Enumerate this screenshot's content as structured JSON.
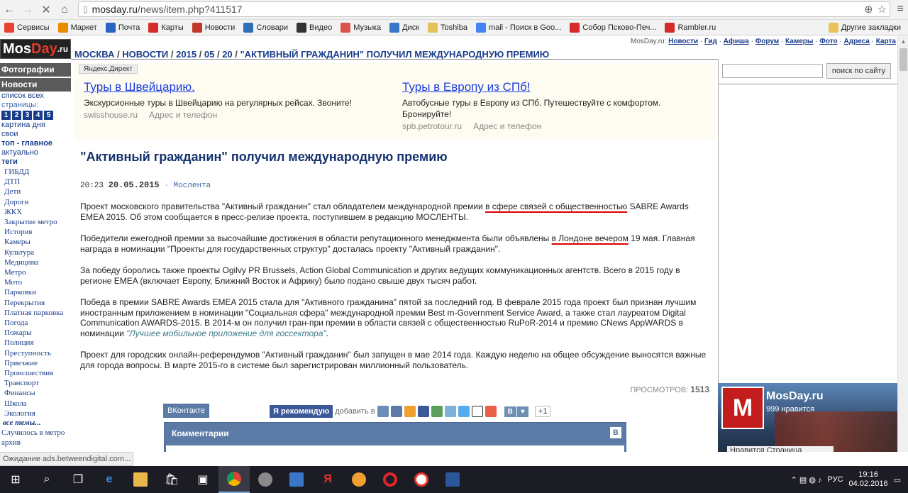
{
  "browser": {
    "url_host": "mosday.ru",
    "url_path": "/news/item.php?411517",
    "bookmarks": [
      {
        "label": "Сервисы",
        "color": "#e94235"
      },
      {
        "label": "Маркет",
        "color": "#e88b00"
      },
      {
        "label": "Почта",
        "color": "#2a63c2"
      },
      {
        "label": "Карты",
        "color": "#d62b2b"
      },
      {
        "label": "Новости",
        "color": "#c0392b"
      },
      {
        "label": "Словари",
        "color": "#2e6fb7"
      },
      {
        "label": "Видео",
        "color": "#333333"
      },
      {
        "label": "Музыка",
        "color": "#d9534f"
      },
      {
        "label": "Диск",
        "color": "#3a77c9"
      },
      {
        "label": "Toshiba",
        "color": "#e2c35a"
      },
      {
        "label": "mail - Поиск в Goo...",
        "color": "#4285f4"
      },
      {
        "label": "Собор Псково-Печ...",
        "color": "#d62b2b"
      },
      {
        "label": "Rambler.ru",
        "color": "#d62b2b"
      }
    ],
    "other_bookmarks": "Другие закладки",
    "status_text": "Ожидание ads.betweendigital.com..."
  },
  "site": {
    "logo_a": "Mos",
    "logo_b": "Day",
    "logo_c": ".ru",
    "top_prefix": "MosDay.ru:",
    "top_links": [
      "Новости",
      "Гид",
      "Афиша",
      "Форум",
      "Камеры",
      "Фото",
      "Адреса",
      "Карта"
    ],
    "breadcrumb": [
      "МОСКВА",
      "НОВОСТИ",
      "2015",
      "05",
      "20",
      "\"АКТИВНЫЙ ГРАЖДАНИН\" ПОЛУЧИЛ МЕЖДУНАРОДНУЮ ПРЕМИЮ"
    ]
  },
  "sidebar": {
    "photos": "Фотографии",
    "news": "Новости",
    "all_list": "список всех",
    "pages_label": "страницы:",
    "pages": [
      "1",
      "2",
      "3",
      "4",
      "5"
    ],
    "picture_of_day": "картина дня",
    "own": "свои",
    "top_main": "топ - главное",
    "actual": "актуально",
    "tags_label": "теги",
    "tags": [
      "ГИБДД",
      "ДТП",
      "Дети",
      "Дороги",
      "ЖКХ",
      "Закрытие метро",
      "История",
      "Камеры",
      "Культура",
      "Медицина",
      "Метро",
      "Мото",
      "Парковки",
      "Перекрытия",
      "Платная парковка",
      "Погода",
      "Пожары",
      "Полиция",
      "Преступность",
      "Приезжие",
      "Происшествия",
      "Транспорт",
      "Финансы",
      "Школа",
      "Экология"
    ],
    "all_topics": "все темы...",
    "happened_metro": "Случилось в метро",
    "archive": "архив"
  },
  "ad": {
    "label": "Яндекс.Директ",
    "items": [
      {
        "title": "Туры в Швейцарию.",
        "text": "Экскурсионные туры в Швейцарию на регулярных рейсах. Звоните!",
        "domain": "swisshouse.ru",
        "contact": "Адрес и телефон"
      },
      {
        "title": "Туры в Европу из СПб!",
        "text": "Автобусные туры в Европу из СПб. Путешествуйте с комфортом. Бронируйте!",
        "domain": "spb.petrotour.ru",
        "contact": "Адрес и телефон"
      }
    ]
  },
  "article": {
    "title": "\"Активный гражданин\" получил международную премию",
    "time": "20:23",
    "date": "20.05.2015",
    "dash": "-",
    "source": "Мослента",
    "p1a": "Проект московского правительства \"Активный гражданин\" стал обладателем международной премии ",
    "p1u": "в сфере связей с общественностью",
    "p1b": " SABRE Awards EMEA 2015. Об этом сообщается в пресс-релизе проекта, поступившем в редакцию МОСЛЕНТЫ.",
    "p2a": "Победители ежегодной премии за высочайшие достижения в области репутационного менеджмента были объявлены ",
    "p2u": "в Лондоне вечером",
    "p2b": " 19 мая. Главная награда в номинации \"Проекты для государственных структур\" досталась проекту \"Активный гражданин\".",
    "p3": "За победу боролись также проекты Ogilvy PR Brussels, Action Global Communication и других ведущих коммуникационных агентств. Всего в 2015 году в регионе EMEA (включает Европу, Ближний Восток и Африку) было подано свыше двух тысяч работ.",
    "p4a": "Победа в премии SABRE Awards EMEA 2015 стала для \"Активного гражданина\" пятой за последний год. В феврале 2015 года проект был признан лучшим иностранным приложением в номинации \"Социальная сфера\" международной премии Best m-Government Service Award, а также стал лауреатом Digital Communication AWARDS-2015. В 2014-м он получил гран-при премии в области связей с общественностью RuPoR-2014 и премию CNews AppWARDS в номинации ",
    "p4q": "\"Лучшее мобильное приложение для госсектора\"",
    "p4b": ".",
    "p5": "Проект для городских онлайн-референдумов \"Активный гражданин\" был запущен в мае 2014 года. Каждую неделю на общее обсуждение выносятся важные для города вопросы. В марте 2015-го в системе был зарегистрирован миллионный пользователь.",
    "views_label": "ПРОСМОТРОВ:",
    "views": "1513"
  },
  "social": {
    "vk_tab": "ВКонтакте",
    "fb_recommend": "Я рекомендую",
    "add_to": "добавить в",
    "plusone": "+1",
    "comments": "Комментарии",
    "vk_letter": "B"
  },
  "right": {
    "search_btn": "поиск по сайту",
    "fb_name": "MosDay.ru",
    "fb_likes": "999 нравится",
    "fb_bar": "Нравится Страница"
  },
  "taskbar": {
    "lang": "РУС",
    "time": "19:16",
    "date": "04.02.2016"
  }
}
